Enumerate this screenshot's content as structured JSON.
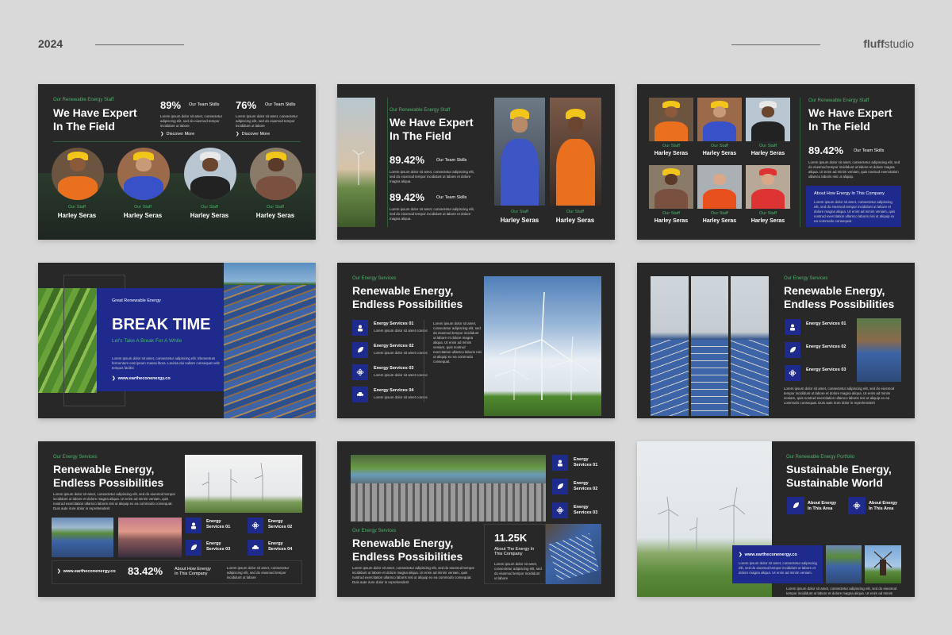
{
  "header": {
    "year": "2024",
    "brand_bold": "fluff",
    "brand_rest": "studio"
  },
  "colors": {
    "accent_green": "#4bb46b",
    "accent_blue": "#1e2a8c",
    "slide_bg": "#282828",
    "page_bg": "#d9d9d9"
  },
  "s1": {
    "eyebrow": "Our Renewable Energy Staff",
    "title_l1": "We Have Expert",
    "title_l2": "In The Field",
    "stat1_value": "89%",
    "stat1_label": "Our Team Skills",
    "stat2_value": "76%",
    "stat2_label": "Our Team Skills",
    "para": "Lorem ipsum dolor sit amet, consectetur adipiscing elit, sed do eiusmod tempor incididunt ut labore",
    "link1": "Discover More",
    "link2": "Discover More",
    "staff_label": "Our Staff",
    "staff_name": "Harley Seras"
  },
  "s2": {
    "eyebrow": "Our Renewable Energy Staff",
    "title_l1": "We Have Expert",
    "title_l2": "In The Field",
    "stat1_value": "89.42%",
    "stat1_label": "Our Team Skills",
    "stat2_value": "89.42%",
    "stat2_label": "Our Team Skills",
    "para": "Lorem ipsum dolor sit amet, consectetur adipiscing elit, sed do eiusmod tempor incididunt ut labore et dolore magna aliqua.",
    "staff_label": "Our Staff",
    "staff_name": "Harley Seras"
  },
  "s3": {
    "eyebrow": "Our Renewable Energy Staff",
    "title_l1": "We Have Expert",
    "title_l2": "In The Field",
    "stat_value": "89.42%",
    "stat_label": "Our Team Skills",
    "para": "Lorem ipsum dolor sit amet, consectetur adipiscing elit, sed do eiusmod tempor incididunt ut labore et dolore magna aliqua. Ut enim ad minim veniam, quis nostrud exercitation ullamco laboris nisi ut aliquip.",
    "box_title": "About How Energy In This Company",
    "box_para": "Lorem ipsum dolor sit amet, consectetur adipiscing elit, sed do eiusmod tempor incididunt ut labore et dolore magna aliqua. Ut enim ad minim veniam, quis nostrud exercitation ullamco laboris nisi ut aliquip ex ea commodo consequat.",
    "staff_label": "Our Staff",
    "staff_name": "Harley Seras"
  },
  "s4": {
    "eyebrow": "Great Renewable Energy",
    "title": "BREAK TIME",
    "subtitle": "Let's Take A Break For A While",
    "para": "Lorem ipsum dolor sit amet, consectetur adipiscing elit. Elementum fermentum erat ipsum massa litora. Lacinia dui nullam consequat velit tempus facilisi",
    "link": "www.eartheconenergy.co"
  },
  "s5": {
    "eyebrow": "Our Energy Services",
    "title_l1": "Renewable Energy,",
    "title_l2": "Endless Possibilities",
    "services": [
      "Energy Services 01",
      "Energy Services 02",
      "Energy Services 03",
      "Energy Services 04"
    ],
    "svc_para": "Lorem ipsum dolor sit amet consec",
    "para": "Lorem ipsum dolor sit amet, consectetur adipiscing elit, sed do eiusmod tempor incididunt ut labore et dolore magna aliqua. Ut enim ad minim veniam, quis nostrud exercitation ullamco laboris nisi ut aliquip ex ea commodo consequat."
  },
  "s6": {
    "eyebrow": "Our Energy Services",
    "title_l1": "Renewable Energy,",
    "title_l2": "Endless Possibilities",
    "services": [
      "Energy Services 01",
      "Energy Services 02",
      "Energy Services 03"
    ],
    "para": "Lorem ipsum dolor sit amet, consectetur adipiscing elit, sed do eiusmod tempor incididunt ut labore et dolore magna aliqua. Ut enim ad minim veniam, quis nostrud exercitation ullamco laboris nisi ut aliquip ex ea commodo consequat. Duis aute irure dolor in reprehenderit"
  },
  "s7": {
    "eyebrow": "Our Energy Services",
    "title_l1": "Renewable Energy,",
    "title_l2": "Endless Possibilities",
    "para": "Lorem ipsum dolor sit amet, consectetur adipiscing elit, sed do eiusmod tempor incididunt ut labore et dolore magna aliqua. Ut enim ad minim veniam, quis nostrud exercitation ullamco laboris nisi ut aliquip ex ea commodo consequat. Duis aute irure dolor in reprehenderit",
    "services": [
      [
        "Energy",
        "Services 01"
      ],
      [
        "Energy",
        "Services 02"
      ],
      [
        "Energy",
        "Services 03"
      ],
      [
        "Energy",
        "Services 04"
      ]
    ],
    "link": "www.eartheconenergy.co",
    "stat_value": "83.42%",
    "stat_label_l1": "About How Energy",
    "stat_label_l2": "In This Company",
    "stat_para": "Lorem ipsum dolor sit amet, consectetur adipiscing elit, sed do eiusmod tempor incididunt ut labore"
  },
  "s8": {
    "services": [
      [
        "Energy",
        "Services 01"
      ],
      [
        "Energy",
        "Services 02"
      ],
      [
        "Energy",
        "Services 03"
      ]
    ],
    "eyebrow": "Our Energy Services",
    "title_l1": "Renewable Energy,",
    "title_l2": "Endless Possibilities",
    "para": "Lorem ipsum dolor sit amet, consectetur adipiscing elit, sed do eiusmod tempor incididunt ut labore et dolore magna aliqua. Ut enim ad minim veniam, quis nostrud exercitation ullamco laboris nisi ut aliquip ex ea commodo consequat. Duis aute irure dolor in reprehenderit",
    "stat_value": "11.25K",
    "stat_label_l1": "About The Energy In",
    "stat_label_l2": "This Company",
    "stat_para": "Lorem ipsum dolor sit amet, consectetur adipiscing elit, sed do eiusmod tempor incididunt ut labore"
  },
  "s9": {
    "eyebrow": "Our Renewable Energy Portfolio",
    "title_l1": "Sustainable Energy,",
    "title_l2": "Sustainable World",
    "items": [
      [
        "About Energy",
        "In This Area"
      ],
      [
        "About Energy",
        "In This Area"
      ]
    ],
    "link": "www.eartheconenergy.co",
    "box_para": "Lorem ipsum dolor sit amet, consectetur adipiscing elit, sed do eiusmod tempor incididunt ut labore et dolore magna aliqua. Ut enim ad minim veniam.",
    "para": "Lorem ipsum dolor sit amet, consectetur adipiscing elit, sed do eiusmod tempor incididunt ut labore et dolore magna aliqua. Ut enim ad minim veniam, quis nostrud exercitation ullamco laboris nisi ut aliquip ex ea commodo consequat. Duis aute irure dolor in reprehenderit"
  }
}
